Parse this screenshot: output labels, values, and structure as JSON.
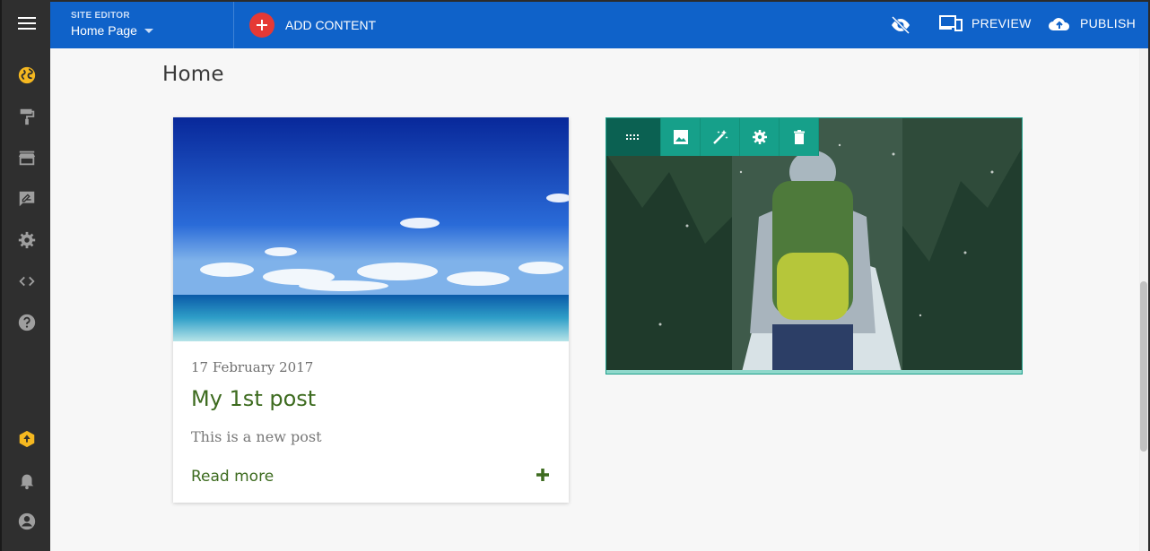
{
  "topbar": {
    "editor_label": "SITE EDITOR",
    "page_name": "Home Page",
    "add_content": "ADD CONTENT",
    "preview": "PREVIEW",
    "publish": "PUBLISH",
    "color": "#0f62c9"
  },
  "sidebar": {
    "items": [
      {
        "icon": "globe-icon"
      },
      {
        "icon": "paint-roller-icon"
      },
      {
        "icon": "store-icon"
      },
      {
        "icon": "edit-note-icon"
      },
      {
        "icon": "gear-icon"
      },
      {
        "icon": "code-icon"
      },
      {
        "icon": "help-icon"
      },
      {
        "icon": "upgrade-icon"
      },
      {
        "icon": "bell-icon"
      },
      {
        "icon": "account-icon"
      }
    ]
  },
  "main": {
    "page_title": "Home",
    "post": {
      "date": "17 February 2017",
      "title": "My 1st post",
      "description": "This is a new post",
      "read_more": "Read more"
    }
  },
  "colors": {
    "accent_red": "#e53935",
    "toolbar_teal": "#16a08a",
    "link_green": "#3d6b1f",
    "highlight_yellow": "#f5b820"
  }
}
